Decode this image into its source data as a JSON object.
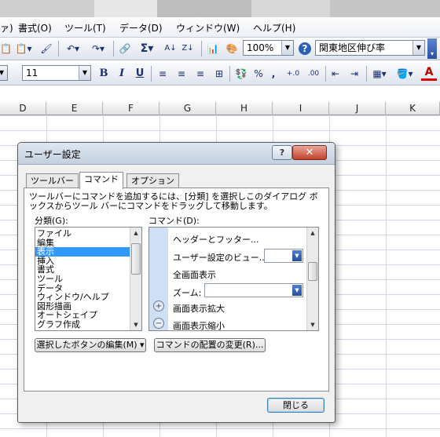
{
  "menubar": {
    "items": [
      "ァ)",
      "書式(O)",
      "ツール(T)",
      "データ(D)",
      "ウィンドウ(W)",
      "ヘルプ(H)"
    ]
  },
  "toolbar1": {
    "zoom_value": "100%",
    "search_value": "関東地区伸び率",
    "sigma_label": "Σ"
  },
  "toolbar2": {
    "font_size_value": "11",
    "bold": "B",
    "italic": "I",
    "underline": "U",
    "percent": "%",
    "comma": ",",
    "dec_inc": "+.0",
    "dec_dec": ".00",
    "font_color_letter": "A"
  },
  "sheet": {
    "columns": [
      "D",
      "E",
      "F",
      "G",
      "H",
      "I",
      "J",
      "K"
    ]
  },
  "dialog": {
    "title": "ユーザー設定",
    "help_glyph": "?",
    "close_glyph": "✕",
    "tabs": [
      "ツールバー",
      "コマンド",
      "オプション"
    ],
    "active_tab": 1,
    "description": "ツールバーにコマンドを追加するには、[分類] を選択しこのダイアログ ボックスからツール バーにコマンドをドラッグして移動します。",
    "categories_label": "分類(G):",
    "commands_label": "コマンド(D):",
    "categories": [
      "ファイル",
      "編集",
      "表示",
      "挿入",
      "書式",
      "ツール",
      "データ",
      "ウィンドウ/ヘルプ",
      "図形描画",
      "オートシェイプ",
      "グラフ作成"
    ],
    "selected_category": "表示",
    "commands": [
      "ヘッダーとフッター...",
      "ユーザー設定のビュー...",
      "全画面表示",
      "ズーム:",
      "画面表示拡大",
      "画面表示縮小"
    ],
    "modify_selection_button": "選択したボタンの編集(M) ▾",
    "rearrange_button": "コマンドの配置の変更(R)...",
    "close_button": "閉じる"
  }
}
